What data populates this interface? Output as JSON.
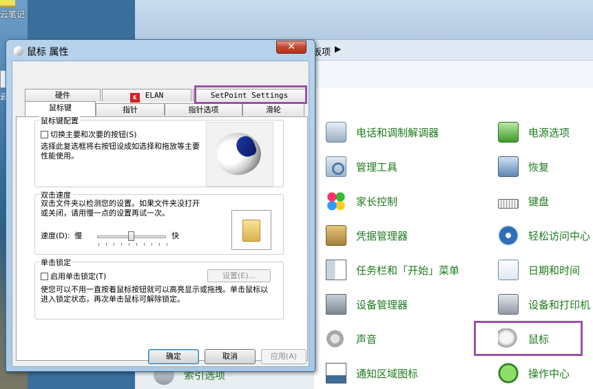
{
  "desktop": {
    "label_top": "云笔记",
    "label_mid": "云"
  },
  "control_panel": {
    "address_text": "板项",
    "address_arrow": "▶",
    "items": [
      {
        "label": "电话和调制解调器",
        "icon": "phone-modem-icon"
      },
      {
        "label": "管理工具",
        "icon": "admin-tools-icon"
      },
      {
        "label": "家长控制",
        "icon": "parental-controls-icon"
      },
      {
        "label": "凭据管理器",
        "icon": "credential-manager-icon"
      },
      {
        "label": "任务栏和「开始」菜单",
        "icon": "taskbar-start-menu-icon"
      },
      {
        "label": "设备管理器",
        "icon": "device-manager-icon"
      },
      {
        "label": "声音",
        "icon": "sound-icon"
      },
      {
        "label": "通知区域图标",
        "icon": "notification-area-icon"
      },
      {
        "label": "电源选项",
        "icon": "power-options-icon"
      },
      {
        "label": "恢复",
        "icon": "recovery-icon"
      },
      {
        "label": "键盘",
        "icon": "keyboard-icon"
      },
      {
        "label": "轻松访问中心",
        "icon": "ease-of-access-icon"
      },
      {
        "label": "日期和时间",
        "icon": "date-time-icon"
      },
      {
        "label": "设备和打印机",
        "icon": "devices-printers-icon"
      },
      {
        "label": "鼠标",
        "icon": "mouse-icon"
      },
      {
        "label": "操作中心",
        "icon": "action-center-icon"
      },
      {
        "label": "索引选项",
        "icon": "indexing-options-icon"
      }
    ],
    "highlight_color": "#9a4fa8"
  },
  "dialog": {
    "title": "鼠标 属性",
    "close_glyph": "✕",
    "tabs_row1": [
      "硬件",
      "ELAN",
      "SetPoint Settings"
    ],
    "tabs_row2": [
      "鼠标键",
      "指针",
      "指针选项",
      "滑轮"
    ],
    "active_tab": "鼠标键",
    "button_config": {
      "title": "鼠标键配置",
      "checkbox_label": "切换主要和次要的按钮(S)",
      "checked": false,
      "description": "选择此复选框将右按钮设成如选择和拖放等主要性能使用。"
    },
    "double_click": {
      "title": "双击速度",
      "description": "双击文件夹以检测您的设置。如果文件夹没打开或关闭，请用慢一点的设置再试一次。",
      "speed_label": "速度(D):",
      "slow_label": "慢",
      "fast_label": "快",
      "speed_fraction": 0.5
    },
    "click_lock": {
      "title": "单击锁定",
      "checkbox_label": "启用单击锁定(T)",
      "checked": false,
      "settings_button": "设置(E)...",
      "description": "使您可以不用一直按着鼠标按钮就可以高亮显示或拖拽。单击鼠标以进入锁定状态，再次单击鼠标可解除锁定。"
    },
    "buttons": {
      "ok": "确定",
      "cancel": "取消",
      "apply": "应用(A)"
    }
  }
}
